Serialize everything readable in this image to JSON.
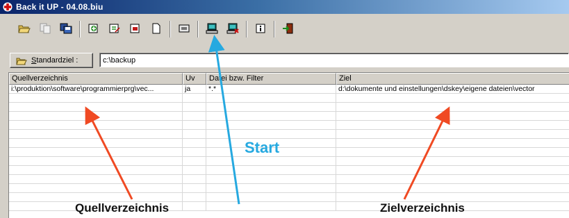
{
  "window": {
    "title": "Back it UP  -  04.08.biu",
    "app_icon": "red-cross-icon"
  },
  "toolbar": {
    "buttons": [
      {
        "name": "open-folder-icon"
      },
      {
        "name": "copy-disabled-icon"
      },
      {
        "name": "save-icon"
      },
      {
        "name": "add-entry-icon"
      },
      {
        "name": "edit-entry-icon"
      },
      {
        "name": "delete-entry-icon"
      },
      {
        "name": "new-document-icon"
      },
      {
        "name": "start-backup-icon"
      },
      {
        "name": "computer-icon"
      },
      {
        "name": "computer-remove-icon"
      },
      {
        "name": "info-icon"
      },
      {
        "name": "exit-icon"
      }
    ]
  },
  "destination": {
    "button_label": "Standardziel :",
    "button_mnemonic": "S",
    "path_value": "c:\\backup"
  },
  "table": {
    "columns": [
      "Quellverzeichnis",
      "Uv",
      "Datei  bzw. Filter",
      "Ziel"
    ],
    "rows": [
      [
        "i:\\produktion\\software\\programmierprg\\vec...",
        "ja",
        "*.*",
        "d:\\dokumente und einstellungen\\dskey\\eigene dateien\\vector"
      ]
    ]
  },
  "annotations": {
    "start_label": "Start",
    "source_label": "Quellverzeichnis",
    "target_label": "Zielverzeichnis",
    "colors": {
      "source_arrow": "#f04a23",
      "start_arrow": "#26a9e0",
      "target_arrow": "#f04a23"
    }
  }
}
